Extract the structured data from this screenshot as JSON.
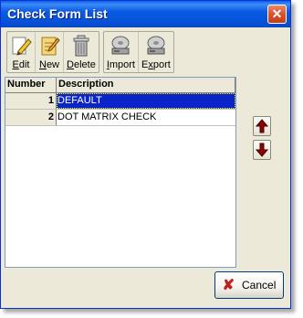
{
  "window": {
    "title": "Check Form List",
    "close_glyph": "✕"
  },
  "toolbar": {
    "buttons": [
      {
        "label_u": "E",
        "label_rest": "dit",
        "icon": "edit-pencil-icon"
      },
      {
        "label_u": "N",
        "label_rest": "ew",
        "icon": "new-document-icon"
      },
      {
        "label_u": "D",
        "label_rest": "elete",
        "icon": "trash-can-icon"
      },
      {
        "label_u": "I",
        "label_rest": "mport",
        "icon": "disk-import-icon"
      },
      {
        "label_pre": "E",
        "label_u": "x",
        "label_rest": "port",
        "icon": "disk-export-icon"
      }
    ]
  },
  "grid": {
    "columns": [
      "Number",
      "Description"
    ],
    "rows": [
      {
        "number": "1",
        "description": "DEFAULT",
        "selected": true
      },
      {
        "number": "2",
        "description": "DOT MATRIX CHECK",
        "selected": false
      }
    ]
  },
  "buttons": {
    "move_up": "up-arrow-icon",
    "move_down": "down-arrow-icon",
    "cancel_label": "Cancel"
  },
  "colors": {
    "title_bar": "#0b5ae3",
    "selection": "#0a24c8",
    "arrow": "#8b0000",
    "cancel_x": "#c0201a"
  }
}
